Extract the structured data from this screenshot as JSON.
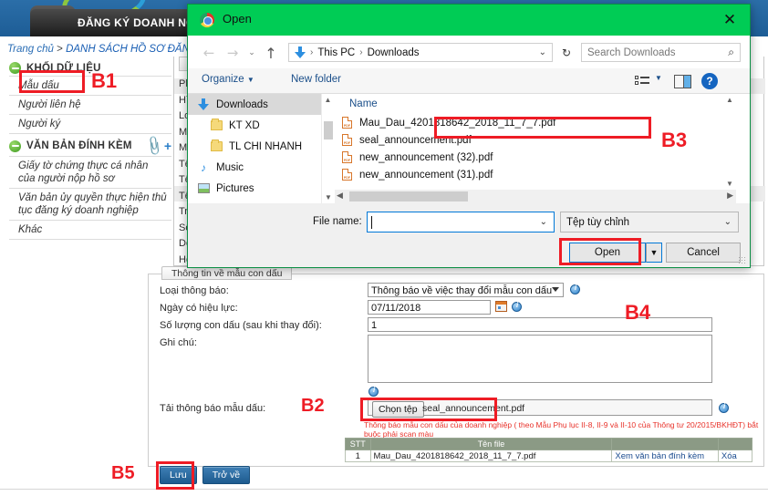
{
  "app": {
    "nav_tab": "ĐĂNG KÝ DOANH NGHIỆP",
    "breadcrumb_home": "Trang chủ",
    "breadcrumb_sep": ">",
    "breadcrumb_current": "DANH SÁCH HỒ SƠ ĐĂNG",
    "tree": {
      "group1": "KHỐI DỮ LIỆU",
      "group1_items": [
        "Mẫu dấu",
        "Người liên hệ",
        "Người ký"
      ],
      "group2": "VĂN BẢN ĐÍNH KÈM",
      "group2_items": [
        "Giấy tờ chứng thực cá nhân của người nộp hồ sơ",
        "Văn bản ủy quyền thực hiện thủ tục đăng ký doanh nghiệp",
        "Khác"
      ]
    },
    "bg_panel": {
      "tab": "Th",
      "lines": [
        "Phư",
        "Hình",
        "Loại",
        "Mã s",
        "Mã s",
        "Tên",
        "Tên",
        "Tên",
        "Trạn",
        "Số h",
        "Doa",
        "Hoạt"
      ]
    },
    "form": {
      "tab": "Thông tin về mẫu con dấu",
      "label_loai": "Loại thông báo:",
      "value_loai": "Thông báo về việc thay đổi mẫu con dấu",
      "label_ngay": "Ngày có hiệu lực:",
      "value_ngay": "07/11/2018",
      "label_soluong": "Số lượng con dấu (sau khi thay đổi):",
      "value_soluong": "1",
      "label_ghichu": "Ghi chú:",
      "value_ghichu": "",
      "label_tai": "Tải thông báo mẫu dấu:",
      "choose_file_button": "Chọn tệp",
      "chosen_file_name": "seal_announcement.pdf",
      "warning": "Thông báo mẫu con dấu của doanh nghiệp ( theo Mẫu Phụ lục II-8, II-9 và II-10 của Thông tư 20/2015/BKHĐT) bắt buộc phải scan màu"
    },
    "attachments": {
      "headers": [
        "STT",
        "Tên file",
        "",
        ""
      ],
      "rows": [
        [
          "1",
          "Mau_Dau_4201818642_2018_11_7_7.pdf",
          "Xem văn bản đính kèm",
          "Xóa"
        ]
      ]
    },
    "buttons": {
      "save": "Lưu",
      "back": "Trở về"
    }
  },
  "dialog": {
    "title": "Open",
    "close_label": "✕",
    "address": {
      "this_pc": "This PC",
      "folder": "Downloads",
      "separator": "›",
      "back_arrow": "←",
      "forward_arrow": "→",
      "recent_caret": "⌄",
      "up_arrow": "↑",
      "refresh": "↻",
      "caret": "⌄"
    },
    "search_placeholder": "Search Downloads",
    "search_value": "",
    "search_icon": "⌕",
    "toolbar": {
      "organize": "Organize",
      "organize_caret": "▼",
      "new_folder": "New folder",
      "view_caret": "▼",
      "help": "?"
    },
    "nav_pane": [
      {
        "label": "Downloads",
        "icon": "download-arrow",
        "selected": true
      },
      {
        "label": "KT XD",
        "icon": "folder",
        "selected": false
      },
      {
        "label": "TL CHI NHANH",
        "icon": "folder",
        "selected": false
      },
      {
        "label": "Music",
        "icon": "music-note",
        "selected": false
      },
      {
        "label": "Pictures",
        "icon": "picture",
        "selected": false
      }
    ],
    "file_list": {
      "column_header": "Name",
      "files": [
        "Mau_Dau_4201818642_2018_11_7_7.pdf",
        "seal_announcement.pdf",
        "new_announcement (32).pdf",
        "new_announcement (31).pdf"
      ]
    },
    "footer": {
      "file_name_label": "File name:",
      "file_name_value": "",
      "file_type_value": "Tệp tùy chỉnh",
      "open_button": "Open",
      "open_split_caret": "▼",
      "cancel_button": "Cancel"
    }
  },
  "annotations": {
    "b1": "B1",
    "b2": "B2",
    "b3": "B3",
    "b4": "B4",
    "b5": "B5"
  },
  "colors": {
    "dialog_title_bg": "#00cc55",
    "annotation_red": "#ee1c25",
    "header_blue": "#2b6ea8",
    "table_header": "#8b9a85"
  }
}
